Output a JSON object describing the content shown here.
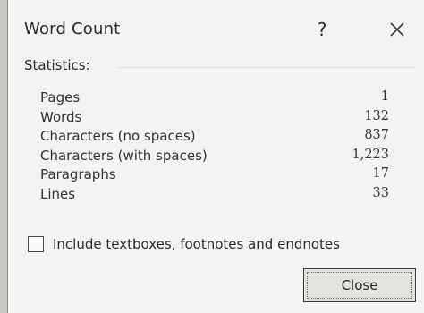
{
  "dialog": {
    "title": "Word Count",
    "help_label": "?",
    "close_icon": "close-icon"
  },
  "statistics": {
    "group_label": "Statistics:",
    "rows": [
      {
        "label": "Pages",
        "value": "1"
      },
      {
        "label": "Words",
        "value": "132"
      },
      {
        "label": "Characters (no spaces)",
        "value": "837"
      },
      {
        "label": "Characters (with spaces)",
        "value": "1,223"
      },
      {
        "label": "Paragraphs",
        "value": "17"
      },
      {
        "label": "Lines",
        "value": "33"
      }
    ]
  },
  "include_option": {
    "label": "Include textboxes, footnotes and endnotes",
    "checked": false
  },
  "buttons": {
    "close_label": "Close"
  }
}
